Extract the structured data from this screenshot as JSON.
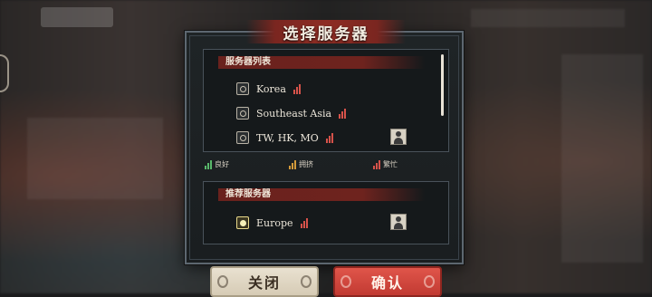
{
  "dialog": {
    "title": "选择服务器"
  },
  "server_list": {
    "header": "服务器列表",
    "items": [
      {
        "name": "Korea",
        "status": "busy",
        "has_character": false
      },
      {
        "name": "Southeast Asia",
        "status": "busy",
        "has_character": false
      },
      {
        "name": "TW, HK, MO",
        "status": "busy",
        "has_character": true
      }
    ]
  },
  "legend": {
    "good": "良好",
    "crowded": "拥挤",
    "busy": "繁忙"
  },
  "recommended": {
    "header": "推荐服务器",
    "items": [
      {
        "name": "Europe",
        "status": "busy",
        "selected": true,
        "has_character": true
      }
    ]
  },
  "buttons": {
    "close": "关闭",
    "confirm": "确认"
  },
  "colors": {
    "good": "#58b86a",
    "crowded": "#d39a3a",
    "busy": "#d6524a",
    "accent_red": "#8e2d24"
  }
}
